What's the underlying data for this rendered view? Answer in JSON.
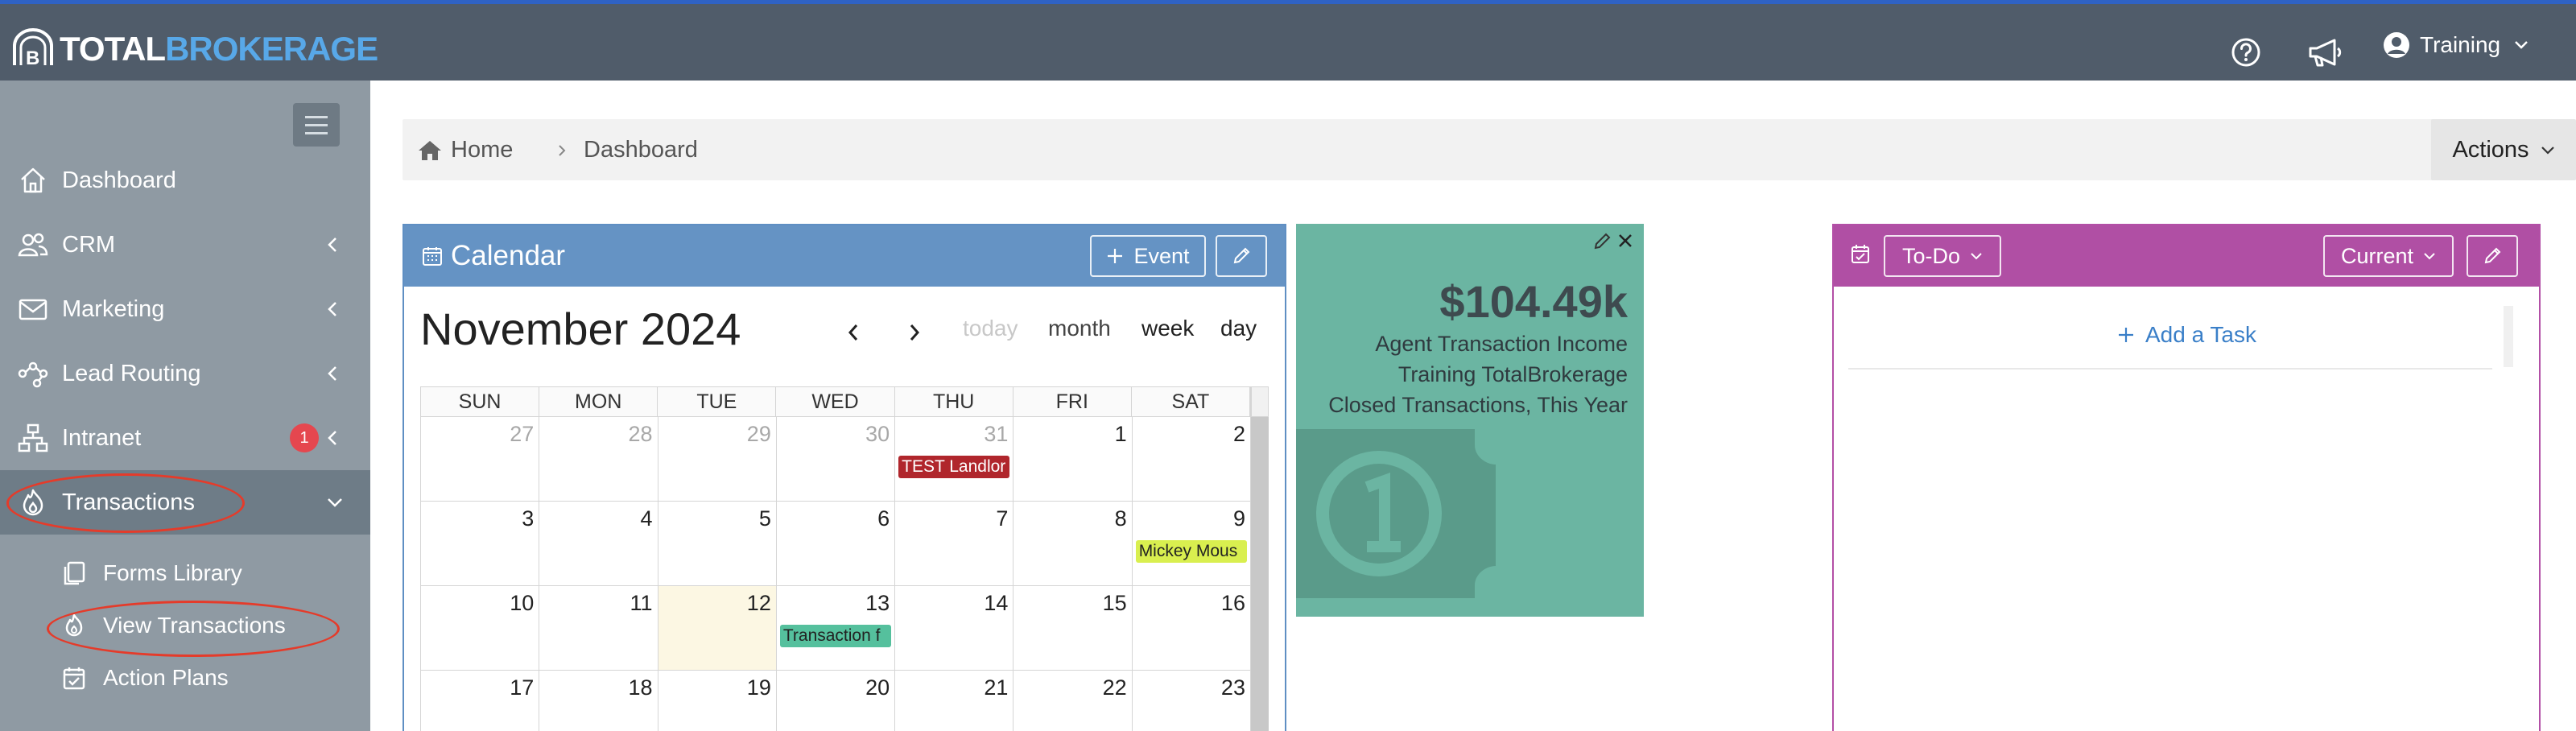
{
  "topbar": {
    "logo_part1": "TOTAL",
    "logo_part2": "BROKERAGE",
    "user_name": "Training",
    "icons": [
      "help-icon",
      "megaphone-icon",
      "user-avatar-icon",
      "chevron-down-icon"
    ],
    "colors": {
      "bar": "#505c6a",
      "accent_top": "#2f62c4",
      "logo_accent": "#58a8e8"
    }
  },
  "sidebar": {
    "items": [
      {
        "label": "Dashboard",
        "icon": "home-icon"
      },
      {
        "label": "CRM",
        "icon": "people-icon"
      },
      {
        "label": "Marketing",
        "icon": "envelope-icon"
      },
      {
        "label": "Lead Routing",
        "icon": "network-icon"
      },
      {
        "label": "Intranet",
        "icon": "sitemap-icon",
        "badge": "1"
      },
      {
        "label": "Transactions",
        "icon": "fire-icon"
      }
    ],
    "sub_items": [
      {
        "label": "Forms Library",
        "icon": "copy-icon"
      },
      {
        "label": "View Transactions",
        "icon": "fire-icon"
      },
      {
        "label": "Action Plans",
        "icon": "calendar-check-icon"
      }
    ]
  },
  "breadcrumb": {
    "home": "Home",
    "current": "Dashboard",
    "actions_label": "Actions"
  },
  "calendar": {
    "title": "Calendar",
    "event_button": "Event",
    "month_title": "November 2024",
    "views": {
      "today": "today",
      "month": "month",
      "week": "week",
      "day": "day"
    },
    "days_of_week": [
      "SUN",
      "MON",
      "TUE",
      "WED",
      "THU",
      "FRI",
      "SAT"
    ],
    "weeks": [
      [
        "27",
        "28",
        "29",
        "30",
        "31",
        "1",
        "2"
      ],
      [
        "3",
        "4",
        "5",
        "6",
        "7",
        "8",
        "9"
      ],
      [
        "10",
        "11",
        "12",
        "13",
        "14",
        "15",
        "16"
      ],
      [
        "17",
        "18",
        "19",
        "20",
        "21",
        "22",
        "23"
      ]
    ],
    "events": [
      {
        "text": "TEST Landlor",
        "color": "#b0262c"
      },
      {
        "text": "Mickey Mous",
        "color": "#d9ef4f"
      },
      {
        "text": "Transaction f",
        "color": "#55c09d"
      }
    ]
  },
  "income_widget": {
    "amount": "$104.49k",
    "line1": "Agent Transaction Income",
    "line2": "Training TotalBrokerage",
    "line3": "Closed Transactions, This Year",
    "bg_color": "#6bb5a2"
  },
  "todo": {
    "title": "To-Do",
    "filter": "Current",
    "add_task": "Add a Task",
    "color": "#b04fa4"
  }
}
